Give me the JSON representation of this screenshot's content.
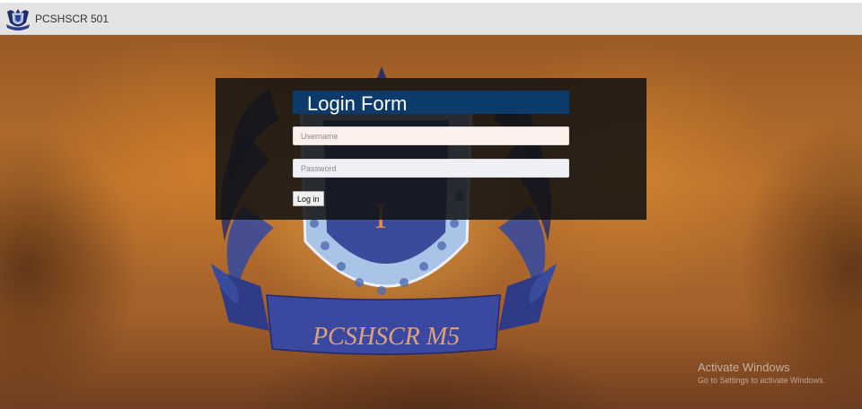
{
  "navbar": {
    "brand_name": "PCSHSCR 501",
    "logo_icon": "school-crest-icon"
  },
  "emblem": {
    "text": "PCSHSCR M5",
    "letter": "I"
  },
  "login": {
    "title": "Login Form",
    "username_placeholder": "Username",
    "password_placeholder": "Password",
    "submit_label": "Log in"
  },
  "watermark": {
    "title": "Activate Windows",
    "subtitle": "Go to Settings to activate Windows."
  },
  "colors": {
    "navbar": "#e3e3e3",
    "form_bg": "#121212",
    "title_bar": "#0c3a6b",
    "emblem_blue": "#3a4a9c",
    "emblem_text": "#e09a6a"
  }
}
